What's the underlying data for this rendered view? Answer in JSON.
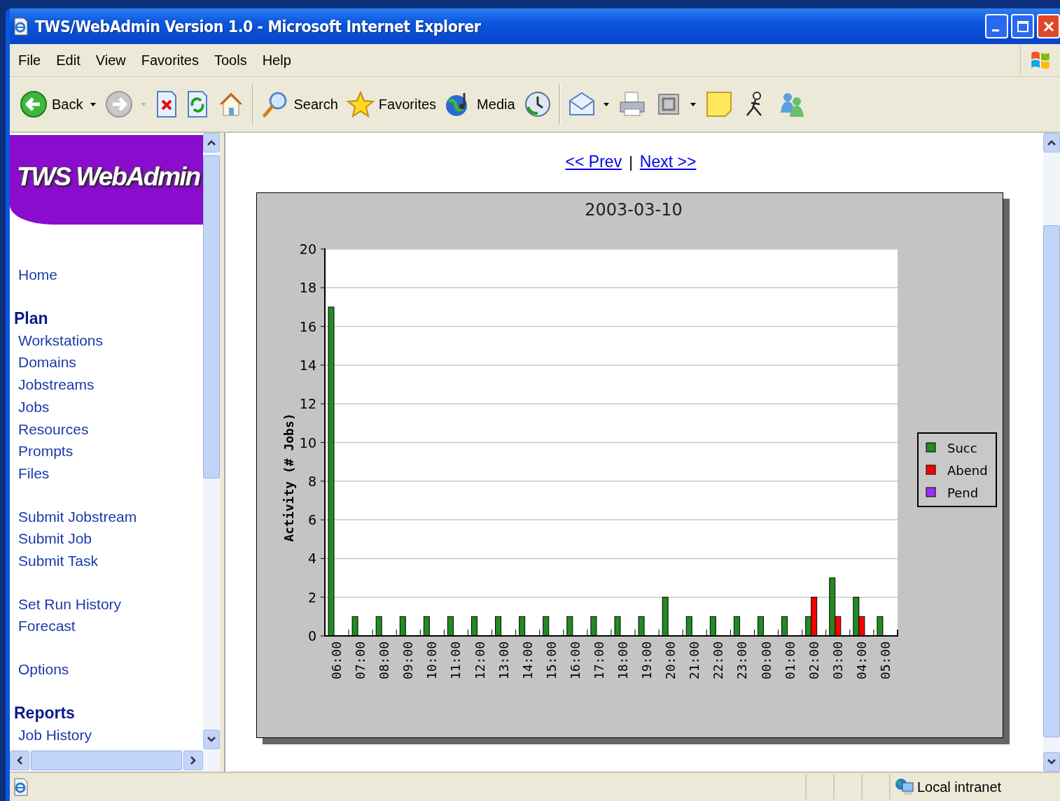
{
  "window": {
    "title": "TWS/WebAdmin Version 1.0 - Microsoft Internet Explorer"
  },
  "menu": [
    "File",
    "Edit",
    "View",
    "Favorites",
    "Tools",
    "Help"
  ],
  "toolbar": [
    {
      "kind": "back",
      "label": "Back",
      "dropdown": true
    },
    {
      "kind": "forward",
      "dropdown": true,
      "disabled": true
    },
    {
      "kind": "stop"
    },
    {
      "kind": "refresh"
    },
    {
      "kind": "home"
    },
    {
      "kind": "search",
      "label": "Search"
    },
    {
      "kind": "favorites",
      "label": "Favorites"
    },
    {
      "kind": "media",
      "label": "Media"
    },
    {
      "kind": "history"
    },
    {
      "kind": "mail",
      "dropdown": true
    },
    {
      "kind": "print"
    },
    {
      "kind": "edit",
      "dropdown": true
    },
    {
      "kind": "note"
    },
    {
      "kind": "discuss"
    },
    {
      "kind": "messenger"
    }
  ],
  "sidebar": {
    "logo": "TWS WebAdmin",
    "groups": [
      {
        "links": [
          "Home"
        ]
      },
      {
        "heading": "Plan",
        "links": [
          "Workstations",
          "Domains",
          "Jobstreams",
          "Jobs",
          "Resources",
          "Prompts",
          "Files"
        ]
      },
      {
        "links": [
          "Submit Jobstream",
          "Submit Job",
          "Submit Task"
        ]
      },
      {
        "links": [
          "Set Run History",
          "Forecast"
        ]
      },
      {
        "links": [
          "Options"
        ]
      },
      {
        "heading": "Reports",
        "links": [
          "Job History"
        ]
      }
    ]
  },
  "pager": {
    "prev": "<< Prev",
    "separator": "|",
    "next": "Next >>"
  },
  "chart_data": {
    "type": "bar",
    "title": "2003-03-10",
    "ylabel": "Activity (# Jobs)",
    "categories": [
      "06:00",
      "07:00",
      "08:00",
      "09:00",
      "10:00",
      "11:00",
      "12:00",
      "13:00",
      "14:00",
      "15:00",
      "16:00",
      "17:00",
      "18:00",
      "19:00",
      "20:00",
      "21:00",
      "22:00",
      "23:00",
      "00:00",
      "01:00",
      "02:00",
      "03:00",
      "04:00",
      "05:00"
    ],
    "series": [
      {
        "name": "Succ",
        "color": "#228b22",
        "values": [
          17,
          1,
          1,
          1,
          1,
          1,
          1,
          1,
          1,
          1,
          1,
          1,
          1,
          1,
          2,
          1,
          1,
          1,
          1,
          1,
          1,
          3,
          2,
          1
        ]
      },
      {
        "name": "Abend",
        "color": "#ff0000",
        "values": [
          0,
          0,
          0,
          0,
          0,
          0,
          0,
          0,
          0,
          0,
          0,
          0,
          0,
          0,
          0,
          0,
          0,
          0,
          0,
          0,
          2,
          1,
          1,
          0
        ]
      },
      {
        "name": "Pend",
        "color": "#9b30ff",
        "values": [
          0,
          0,
          0,
          0,
          0,
          0,
          0,
          0,
          0,
          0,
          0,
          0,
          0,
          0,
          0,
          0,
          0,
          0,
          0,
          0,
          0,
          0,
          0,
          0
        ]
      }
    ],
    "grid": true,
    "legend": true,
    "ylim": [
      0,
      20
    ],
    "yticks": [
      0,
      2,
      4,
      6,
      8,
      10,
      12,
      14,
      16,
      18,
      20
    ]
  },
  "status_bar": {
    "zone": "Local intranet"
  }
}
